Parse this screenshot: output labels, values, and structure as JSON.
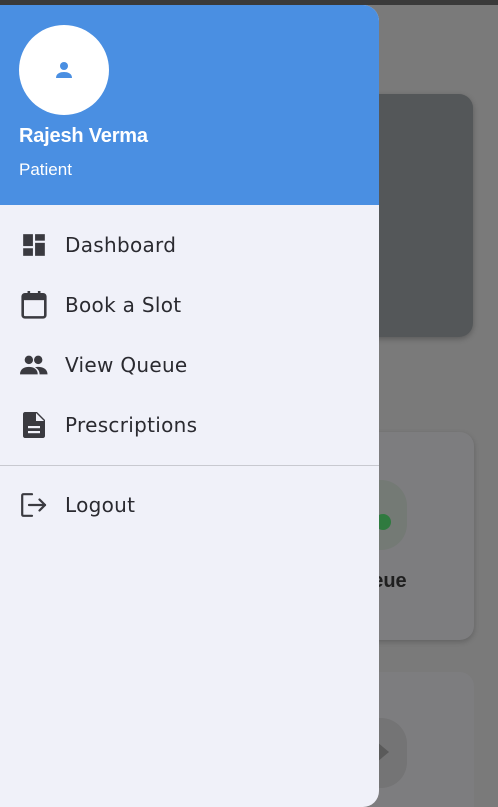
{
  "drawer": {
    "user": {
      "name": "Rajesh Verma",
      "role": "Patient",
      "avatar_icon": "person-icon"
    },
    "menu": [
      {
        "label": "Dashboard",
        "icon": "dashboard-icon"
      },
      {
        "label": "Book a Slot",
        "icon": "calendar-icon"
      },
      {
        "label": "View Queue",
        "icon": "people-icon"
      },
      {
        "label": "Prescriptions",
        "icon": "document-icon"
      }
    ],
    "logout": {
      "label": "Logout",
      "icon": "logout-icon"
    }
  },
  "background": {
    "card_text": "ueue"
  },
  "colors": {
    "header": "#4a8fe2",
    "drawer_bg": "#f0f1f9",
    "icon": "#3a3a40"
  }
}
